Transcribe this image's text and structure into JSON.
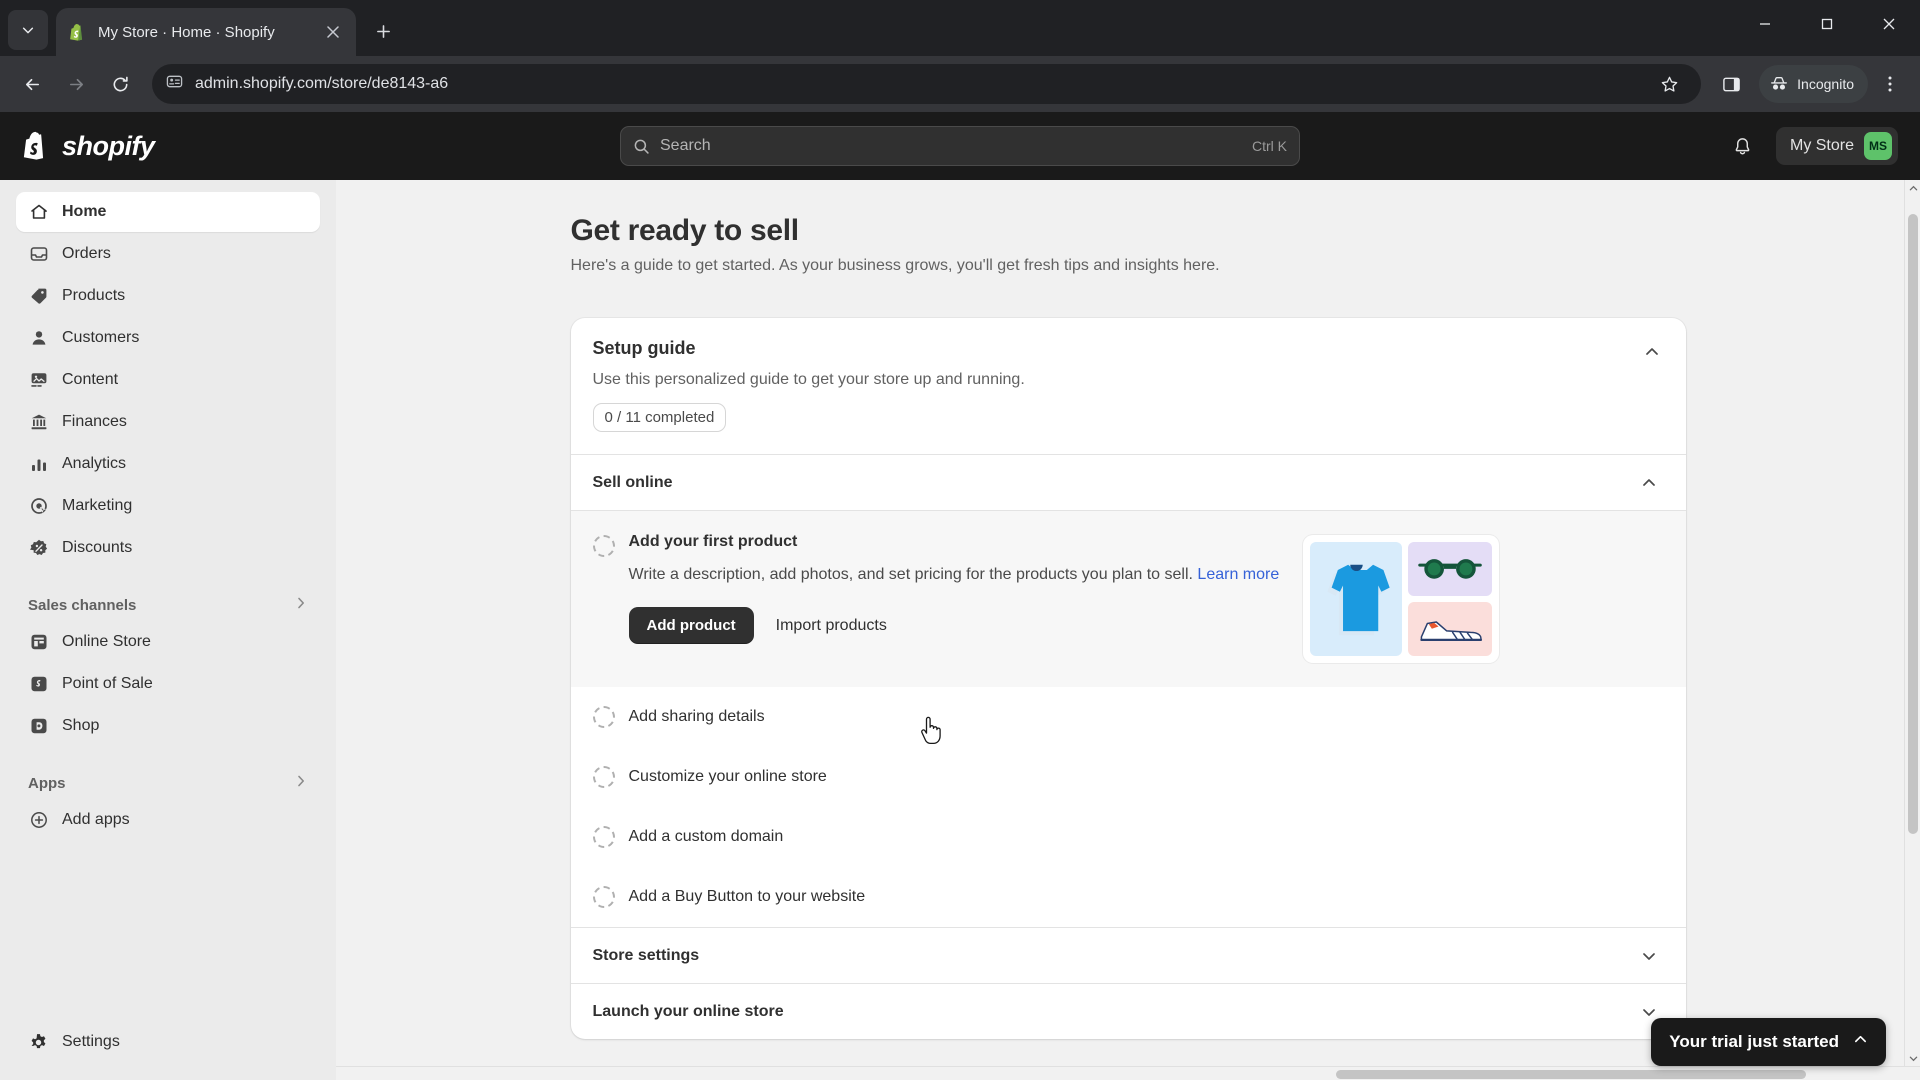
{
  "browser": {
    "tab": {
      "title": "My Store · Home · Shopify",
      "favicon": "shopify-favicon"
    },
    "new_tab_label": "+",
    "url": "admin.shopify.com/store/de8143-a6",
    "incognito_label": "Incognito",
    "window": {
      "minimize": "–",
      "maximize": "□",
      "close": "✕"
    }
  },
  "topbar": {
    "logo_text": "shopify",
    "search": {
      "placeholder": "Search",
      "shortcut": "Ctrl K"
    },
    "store_name": "My Store",
    "store_initials": "MS"
  },
  "sidebar": {
    "items": [
      {
        "label": "Home",
        "icon": "home-icon",
        "active": true
      },
      {
        "label": "Orders",
        "icon": "orders-icon",
        "active": false
      },
      {
        "label": "Products",
        "icon": "products-tag-icon",
        "active": false
      },
      {
        "label": "Customers",
        "icon": "customers-person-icon",
        "active": false
      },
      {
        "label": "Content",
        "icon": "content-image-icon",
        "active": false
      },
      {
        "label": "Finances",
        "icon": "finances-bank-icon",
        "active": false
      },
      {
        "label": "Analytics",
        "icon": "analytics-bars-icon",
        "active": false
      },
      {
        "label": "Marketing",
        "icon": "marketing-target-icon",
        "active": false
      },
      {
        "label": "Discounts",
        "icon": "discounts-badge-icon",
        "active": false
      }
    ],
    "sales_channels": {
      "title": "Sales channels",
      "items": [
        {
          "label": "Online Store",
          "icon": "online-store-icon"
        },
        {
          "label": "Point of Sale",
          "icon": "point-of-sale-icon"
        },
        {
          "label": "Shop",
          "icon": "shop-icon"
        }
      ]
    },
    "apps": {
      "title": "Apps",
      "items": [
        {
          "label": "Add apps",
          "icon": "plus-circle-icon"
        }
      ]
    },
    "settings": {
      "label": "Settings",
      "icon": "gear-icon"
    }
  },
  "main": {
    "page_title": "Get ready to sell",
    "page_subtitle": "Here's a guide to get started. As your business grows, you'll get fresh tips and insights here.",
    "setup_guide": {
      "title": "Setup guide",
      "description": "Use this personalized guide to get your store up and running.",
      "progress_badge": "0 / 11 completed"
    },
    "groups": [
      {
        "title": "Sell online",
        "expanded": true
      },
      {
        "title": "Store settings",
        "expanded": false
      },
      {
        "title": "Launch your online store",
        "expanded": false
      }
    ],
    "active_task": {
      "title": "Add your first product",
      "description_start": "Write a description, add photos, and set pricing for the products you plan to sell. ",
      "link_label": "Learn more",
      "primary_button": "Add product",
      "secondary_button": "Import products"
    },
    "tasks": [
      {
        "label": "Add sharing details"
      },
      {
        "label": "Customize your online store"
      },
      {
        "label": "Add a custom domain"
      },
      {
        "label": "Add a Buy Button to your website"
      }
    ]
  },
  "trial_banner": {
    "label": "Your trial just started",
    "chevron": "chevron-up-icon"
  },
  "colors": {
    "shopify_dark": "#1a1a1a",
    "sidebar_bg": "#ebebeb",
    "page_bg": "#f1f1f1",
    "accent_green": "#5ec26a",
    "link_blue": "#3662d8"
  }
}
